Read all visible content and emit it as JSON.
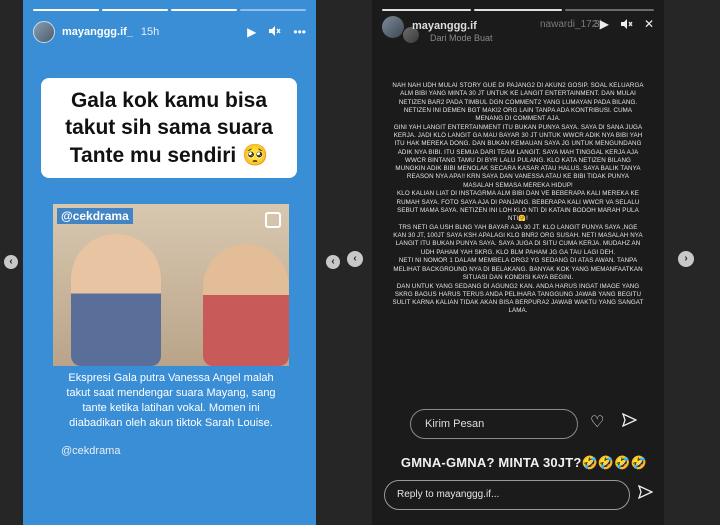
{
  "left_story": {
    "username": "mayanggg.if_",
    "time": "15h",
    "headline": "Gala kok kamu bisa takut sih sama suara Tante mu sendiri 🥺",
    "watermark": "@cekdrama",
    "caption": "Ekspresi Gala putra Vanessa Angel malah takut saat mendengar suara Mayang, sang tante ketika latihan vokal. Momen ini diabadikan oleh akun tiktok Sarah Louise.",
    "credit": "@cekdrama",
    "background_color": "#3a8ed6"
  },
  "icons": {
    "play": "play-icon",
    "mute": "mute-icon",
    "more": "more-icon",
    "close": "close-icon",
    "heart": "heart-icon",
    "send": "send-icon",
    "copy": "copy-icon"
  },
  "right_story": {
    "username": "mayanggg.if",
    "ghost_username": "nawardi_172",
    "ghost_time": "3j",
    "subtitle": "Dari Mode Buat",
    "body_paragraphs": [
      "Nah nah udh mulai story gue di pajang2 di akun2 gosip. Soal keluarga alm bibi yang minta 30 jt untuk ke langit entertainment. Dan mulai netizen bar2 pada timbul dgn comment2 yang lumayan pada bilang. Netizen ini demen bgt maki2 org lain tanpa ada kontribusi. Cuma menang di comment aja.",
      "Gini yah langit entertainment itu bukan punya saya. Saya di sana juga kerja. Jadi klo langit ga mau bayar 30 jt untuk wwcr adik nya bibi yah itu hak mereka dong. Dan bukan kemauan saya jg untuk mengundang adik nya bibi. Itu semua dari team langit. Saya mah tinggal kerja aja wwcr bintang tamu di byr lalu pulang. Klo kata netizen bilang mungkin adik bibi menolak secara kasar atau halus. Saya balik tanya reason nya apa!! Krn saya dan vanessa atau ke bibi tidak punya masalah semasa mereka hidup!",
      "Klo kalian liat di instagrma alm bibi dan ve beberapa kali mereka ke rumah saya. Foto saya aja di panjang. Beberapa kali wwcr va selalu sebut mama saya. Netizen ini loh klo nti di katain bodoh marah pula nti🤗!",
      "Trs neti ga ush blng yah bayar aja 30 jt. Klo langit punya saya ,nge kan 30 jt, 100jt saya ksh apalagi klo bnr2 org susah. Neti masalah nya langit itu bukan punya saya. Saya juga di situ cuma kerja. Mudahz an udh paham yah skrg. Klo blm paham jg ga tau lagi deh.",
      "Neti ni nomor 1 dalam membela org2 yg sedang di atas awan. Tanpa melihat background nya di belakang. Banyak kok yang memanfaatkan situasi dan kondisi kaya begini.",
      "Dan untuk yang sedang di agung2 kan. Anda harus ingat image yang skrg bagus harus terus anda pelihara tanggung jawab yang begitu sulit karna kalian tidak akan bisa berpura2 jawab waktu yang sangat lama."
    ],
    "message_placeholder": "Kirim Pesan",
    "shout_text": "GMNA-GMNA? MINTA 30JT?🤣🤣🤣🤣",
    "reply_placeholder": "Reply to mayanggg.if..."
  },
  "nav": {
    "prev_glyph": "‹",
    "next_glyph": "›"
  }
}
